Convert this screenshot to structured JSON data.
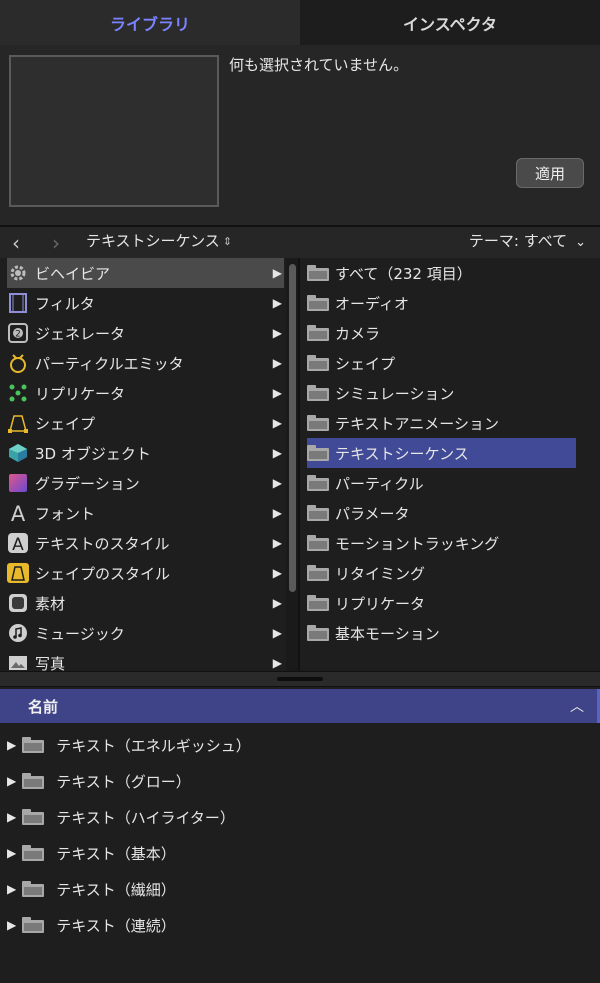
{
  "tabs": {
    "library": "ライブラリ",
    "inspector": "インスペクタ"
  },
  "preview": {
    "message": "何も選択されていません。",
    "apply_label": "適用"
  },
  "nav": {
    "back": "‹",
    "forward": "›",
    "title": "テキストシーケンス",
    "title_arrows": "⌃⌄",
    "theme": "テーマ: すべて",
    "theme_chevron": "⌄"
  },
  "left_items": [
    {
      "label": "ビヘイビア",
      "icon": "gear-icon",
      "selected": true
    },
    {
      "label": "フィルタ",
      "icon": "film-icon"
    },
    {
      "label": "ジェネレータ",
      "icon": "generator-icon"
    },
    {
      "label": "パーティクルエミッタ",
      "icon": "particle-emitter-icon"
    },
    {
      "label": "リプリケータ",
      "icon": "replicator-icon"
    },
    {
      "label": "シェイプ",
      "icon": "shape-icon"
    },
    {
      "label": "3D オブジェクト",
      "icon": "cube-icon"
    },
    {
      "label": "グラデーション",
      "icon": "gradient-icon"
    },
    {
      "label": "フォント",
      "icon": "font-icon"
    },
    {
      "label": "テキストのスタイル",
      "icon": "text-style-icon"
    },
    {
      "label": "シェイプのスタイル",
      "icon": "shape-style-icon"
    },
    {
      "label": "素材",
      "icon": "material-icon"
    },
    {
      "label": "ミュージック",
      "icon": "music-icon"
    },
    {
      "label": "写真",
      "icon": "photo-icon"
    }
  ],
  "right_items": [
    {
      "label": "すべて（232 項目）"
    },
    {
      "label": "オーディオ"
    },
    {
      "label": "カメラ"
    },
    {
      "label": "シェイプ"
    },
    {
      "label": "シミュレーション"
    },
    {
      "label": "テキストアニメーション"
    },
    {
      "label": "テキストシーケンス",
      "selected": true
    },
    {
      "label": "パーティクル"
    },
    {
      "label": "パラメータ"
    },
    {
      "label": "モーショントラッキング"
    },
    {
      "label": "リタイミング"
    },
    {
      "label": "リプリケータ"
    },
    {
      "label": "基本モーション"
    }
  ],
  "list_header": {
    "name": "名前",
    "caret": "⌃"
  },
  "bottom_items": [
    {
      "label": "テキスト（エネルギッシュ）"
    },
    {
      "label": "テキスト（グロー）"
    },
    {
      "label": "テキスト（ハイライター）"
    },
    {
      "label": "テキスト（基本）"
    },
    {
      "label": "テキスト（繊細）"
    },
    {
      "label": "テキスト（連続）"
    }
  ],
  "colors": {
    "accent": "#7b83ff",
    "selection": "#404a96",
    "header": "#3f4489"
  }
}
